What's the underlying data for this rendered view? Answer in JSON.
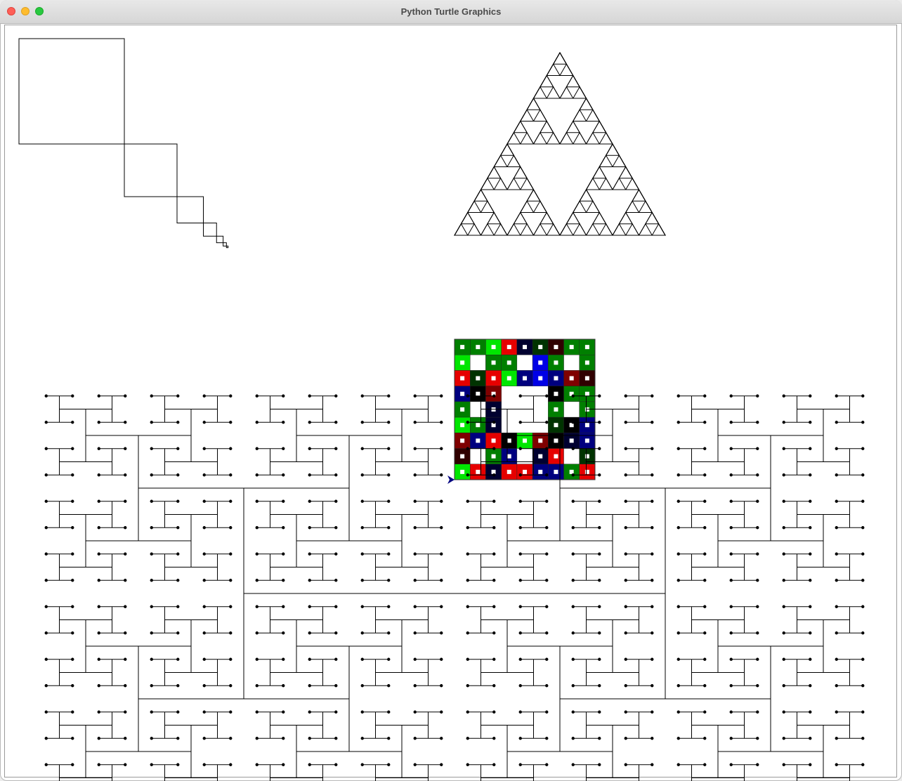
{
  "window": {
    "title": "Python Turtle Graphics"
  },
  "icons": {
    "close": "close-button",
    "minimize": "minimize-button",
    "zoom": "zoom-button",
    "turtle_cursor": "turtle-arrow-icon"
  },
  "colors": {
    "titlebar": "#dcdcdc",
    "canvas_bg": "#ffffff",
    "ink": "#000000",
    "turtle": "#00007f",
    "close_light": "#fe5f57",
    "minimize_light": "#febc2e",
    "zoom_light": "#28c840"
  },
  "drawings": {
    "square_spiral": {
      "shape": "square-spiral",
      "squares": 7,
      "ratio": 0.5
    },
    "sierpinski_triangle": {
      "shape": "sierpinski-triangle",
      "depth": 4
    },
    "sierpinski_carpet": {
      "shape": "sierpinski-carpet",
      "grid": 9,
      "palette": [
        "#7f0000",
        "#e60000",
        "#00007f",
        "#0000e6",
        "#007f00",
        "#00e600",
        "#000000",
        "#003300",
        "#300000",
        "#000030"
      ]
    },
    "h_tree": {
      "shape": "h-tree",
      "levels": 9
    }
  }
}
